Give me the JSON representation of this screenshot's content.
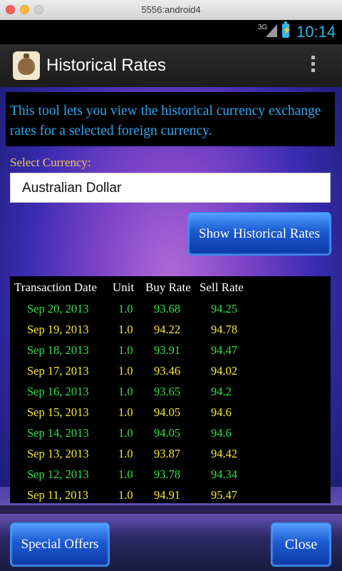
{
  "window": {
    "title": "5556:android4"
  },
  "status_bar": {
    "network": "3G",
    "time": "10:14",
    "battery_glyph": "⚡"
  },
  "action_bar": {
    "title": "Historical Rates",
    "app_icon": "money-bag-icon",
    "menu_icon": "overflow-menu-icon"
  },
  "info_text": "This tool lets you view the historical currency exchange rates for a selected foreign currency.",
  "currency": {
    "label": "Select Currency:",
    "selected": "Australian Dollar"
  },
  "show_button": "Show Historical Rates",
  "table": {
    "headers": {
      "date": "Transaction Date",
      "unit": "Unit",
      "buy": "Buy Rate",
      "sell": "Sell Rate"
    },
    "rows": [
      {
        "date": "Sep 20, 2013",
        "unit": "1.0",
        "buy": "93.68",
        "sell": "94.25",
        "color": "green"
      },
      {
        "date": "Sep 19, 2013",
        "unit": "1.0",
        "buy": "94.22",
        "sell": "94.78",
        "color": "yellow"
      },
      {
        "date": "Sep 18, 2013",
        "unit": "1.0",
        "buy": "93.91",
        "sell": "94.47",
        "color": "green"
      },
      {
        "date": "Sep 17, 2013",
        "unit": "1.0",
        "buy": "93.46",
        "sell": "94.02",
        "color": "yellow"
      },
      {
        "date": "Sep 16, 2013",
        "unit": "1.0",
        "buy": "93.65",
        "sell": "94.2",
        "color": "green"
      },
      {
        "date": "Sep 15, 2013",
        "unit": "1.0",
        "buy": "94.05",
        "sell": "94.6",
        "color": "yellow"
      },
      {
        "date": "Sep 14, 2013",
        "unit": "1.0",
        "buy": "94.05",
        "sell": "94.6",
        "color": "green"
      },
      {
        "date": "Sep 13, 2013",
        "unit": "1.0",
        "buy": "93.87",
        "sell": "94.42",
        "color": "yellow"
      },
      {
        "date": "Sep 12, 2013",
        "unit": "1.0",
        "buy": "93.78",
        "sell": "94.34",
        "color": "green"
      },
      {
        "date": "Sep 11, 2013",
        "unit": "1.0",
        "buy": "94.91",
        "sell": "95.47",
        "color": "yellow"
      }
    ]
  },
  "special_offers_button": "Special Offers",
  "close_button": "Close",
  "colors": {
    "accent": "#33b5e5",
    "info_text": "#2aa8f0",
    "label": "#f2c95a",
    "row_green": "#33e04a",
    "row_yellow": "#f5ea3a",
    "button": "#1c5ad0"
  }
}
